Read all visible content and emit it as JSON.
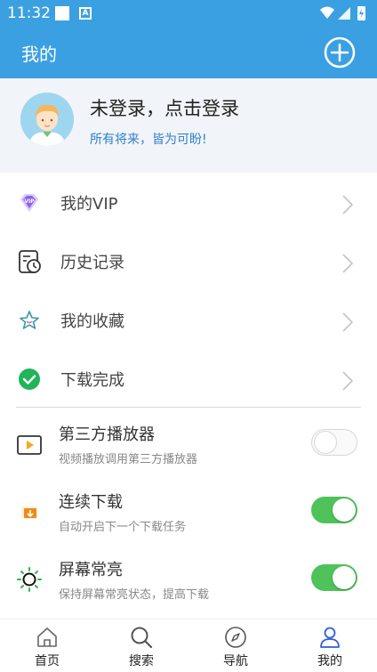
{
  "status_bar": {
    "time": "11:32"
  },
  "app_bar": {
    "title": "我的"
  },
  "profile": {
    "name": "未登录，点击登录",
    "slogan": "所有将来，皆为可盼!"
  },
  "menu": [
    {
      "label": "我的VIP",
      "icon": "vip-diamond-icon"
    },
    {
      "label": "历史记录",
      "icon": "history-clock-icon"
    },
    {
      "label": "我的收藏",
      "icon": "star-icon"
    },
    {
      "label": "下载完成",
      "icon": "check-circle-icon"
    }
  ],
  "settings": [
    {
      "label": "第三方播放器",
      "sub": "视频播放调用第三方播放器",
      "on": false,
      "icon": "player-icon"
    },
    {
      "label": "连续下载",
      "sub": "自动开启下一个下载任务",
      "on": true,
      "icon": "download-box-icon"
    },
    {
      "label": "屏幕常亮",
      "sub": "保持屏幕常亮状态，提高下载",
      "on": true,
      "icon": "sun-icon"
    }
  ],
  "tabs": [
    {
      "label": "首页",
      "icon": "home-icon"
    },
    {
      "label": "搜索",
      "icon": "search-icon"
    },
    {
      "label": "导航",
      "icon": "compass-icon"
    },
    {
      "label": "我的",
      "icon": "user-icon",
      "active": true
    }
  ],
  "colors": {
    "primary": "#3aa0e2",
    "toggle_on": "#4fc25a",
    "slogan": "#2f7fd0",
    "tab_active": "#2f5fd6"
  }
}
